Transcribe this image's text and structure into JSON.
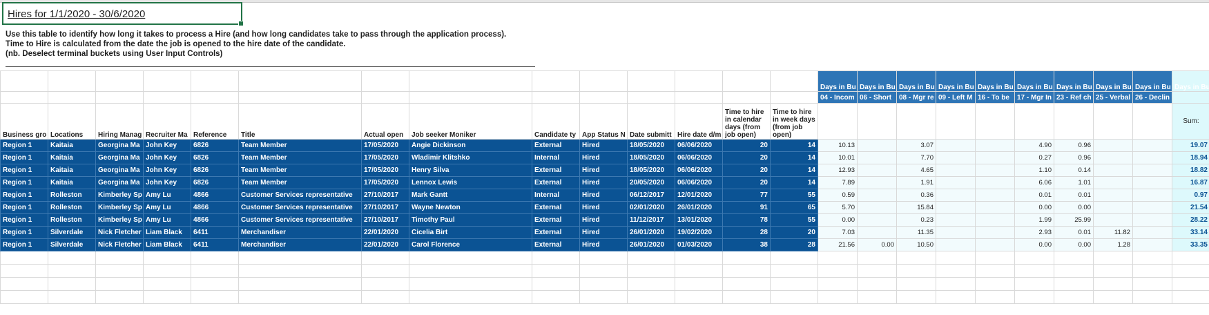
{
  "title": "Hires for 1/1/2020  - 30/6/2020",
  "description": [
    "Use this table to identify how long it takes to process a Hire (and how long candidates take to pass through the application process).",
    "Time to Hire is calculated from the date the job is opened to the hire date of the candidate.",
    "(nb. Deselect terminal buckets using User Input Controls)"
  ],
  "bucket_headers": {
    "top": [
      "Days in Bu",
      "Days in Bu",
      "Days in Bu",
      "Days in Bu",
      "Days in Bu",
      "Days in Bu",
      "Days in Bu",
      "Days in Bu",
      "Days in Bu",
      "Days in Bucket"
    ],
    "sub": [
      "04 - Incom",
      "06 - Short",
      "08 - Mgr re",
      "09 - Left M",
      "16 - To be",
      "17 - Mgr In",
      "23 - Ref ch",
      "25 - Verbal",
      "26 - Declin",
      ""
    ]
  },
  "columns": [
    "Business gro",
    "Locations",
    "Hiring Manag",
    "Recruiter Ma",
    "Reference",
    "Title",
    "Actual open",
    "Job seeker Moniker",
    "Candidate ty",
    "App Status N",
    "Date submitt",
    "Hire date d/m",
    "Time to hire in calendar days (from job open)",
    "Time to hire in week days (from job open)"
  ],
  "sum_label": "Sum:",
  "rows": [
    {
      "bg": "Region 1",
      "loc": "Kaitaia",
      "hm": "Georgina Ma",
      "rm": "John Key",
      "ref": "6826",
      "title": "Team Member",
      "open": "17/05/2020",
      "name": "Angie Dickinson",
      "type": "External",
      "status": "Hired",
      "sub": "18/05/2020",
      "hire": "06/06/2020",
      "cal": "20",
      "wk": "14",
      "b": [
        "10.13",
        "",
        "3.07",
        "",
        "",
        "4.90",
        "0.96",
        "",
        "",
        ""
      ],
      "sum": "19.07"
    },
    {
      "bg": "Region 1",
      "loc": "Kaitaia",
      "hm": "Georgina Ma",
      "rm": "John Key",
      "ref": "6826",
      "title": "Team Member",
      "open": "17/05/2020",
      "name": "Wladimir Klitshko",
      "type": "Internal",
      "status": "Hired",
      "sub": "18/05/2020",
      "hire": "06/06/2020",
      "cal": "20",
      "wk": "14",
      "b": [
        "10.01",
        "",
        "7.70",
        "",
        "",
        "0.27",
        "0.96",
        "",
        "",
        ""
      ],
      "sum": "18.94"
    },
    {
      "bg": "Region 1",
      "loc": "Kaitaia",
      "hm": "Georgina Ma",
      "rm": "John Key",
      "ref": "6826",
      "title": "Team Member",
      "open": "17/05/2020",
      "name": "Henry Silva",
      "type": "External",
      "status": "Hired",
      "sub": "18/05/2020",
      "hire": "06/06/2020",
      "cal": "20",
      "wk": "14",
      "b": [
        "12.93",
        "",
        "4.65",
        "",
        "",
        "1.10",
        "0.14",
        "",
        "",
        ""
      ],
      "sum": "18.82"
    },
    {
      "bg": "Region 1",
      "loc": "Kaitaia",
      "hm": "Georgina Ma",
      "rm": "John Key",
      "ref": "6826",
      "title": "Team Member",
      "open": "17/05/2020",
      "name": "Lennox Lewis",
      "type": "External",
      "status": "Hired",
      "sub": "20/05/2020",
      "hire": "06/06/2020",
      "cal": "20",
      "wk": "14",
      "b": [
        "7.89",
        "",
        "1.91",
        "",
        "",
        "6.06",
        "1.01",
        "",
        "",
        ""
      ],
      "sum": "16.87"
    },
    {
      "bg": "Region 1",
      "loc": "Rolleston",
      "hm": "Kimberley Sp",
      "rm": "Amy Lu",
      "ref": "4866",
      "title": "Customer Services representative",
      "open": "27/10/2017",
      "name": "Mark Gantt",
      "type": "Internal",
      "status": "Hired",
      "sub": "06/12/2017",
      "hire": "12/01/2020",
      "cal": "77",
      "wk": "55",
      "b": [
        "0.59",
        "",
        "0.36",
        "",
        "",
        "0.01",
        "0.01",
        "",
        "",
        ""
      ],
      "sum": "0.97"
    },
    {
      "bg": "Region 1",
      "loc": "Rolleston",
      "hm": "Kimberley Sp",
      "rm": "Amy Lu",
      "ref": "4866",
      "title": "Customer Services representative",
      "open": "27/10/2017",
      "name": "Wayne Newton",
      "type": "External",
      "status": "Hired",
      "sub": "02/01/2020",
      "hire": "26/01/2020",
      "cal": "91",
      "wk": "65",
      "b": [
        "5.70",
        "",
        "15.84",
        "",
        "",
        "0.00",
        "0.00",
        "",
        "",
        ""
      ],
      "sum": "21.54"
    },
    {
      "bg": "Region 1",
      "loc": "Rolleston",
      "hm": "Kimberley Sp",
      "rm": "Amy Lu",
      "ref": "4866",
      "title": "Customer Services representative",
      "open": "27/10/2017",
      "name": "Timothy Paul",
      "type": "External",
      "status": "Hired",
      "sub": "11/12/2017",
      "hire": "13/01/2020",
      "cal": "78",
      "wk": "55",
      "b": [
        "0.00",
        "",
        "0.23",
        "",
        "",
        "1.99",
        "25.99",
        "",
        "",
        ""
      ],
      "sum": "28.22"
    },
    {
      "bg": "Region 1",
      "loc": "Silverdale",
      "hm": "Nick Fletcher",
      "rm": "Liam Black",
      "ref": "6411",
      "title": "Merchandiser",
      "open": "22/01/2020",
      "name": "Cicelia Birt",
      "type": "External",
      "status": "Hired",
      "sub": "26/01/2020",
      "hire": "19/02/2020",
      "cal": "28",
      "wk": "20",
      "b": [
        "7.03",
        "",
        "11.35",
        "",
        "",
        "2.93",
        "0.01",
        "11.82",
        "",
        ""
      ],
      "sum": "33.14"
    },
    {
      "bg": "Region 1",
      "loc": "Silverdale",
      "hm": "Nick Fletcher",
      "rm": "Liam Black",
      "ref": "6411",
      "title": "Merchandiser",
      "open": "22/01/2020",
      "name": "Carol Florence",
      "type": "External",
      "status": "Hired",
      "sub": "26/01/2020",
      "hire": "01/03/2020",
      "cal": "38",
      "wk": "28",
      "b": [
        "21.56",
        "0.00",
        "10.50",
        "",
        "",
        "0.00",
        "0.00",
        "1.28",
        "",
        ""
      ],
      "sum": "33.35"
    }
  ]
}
